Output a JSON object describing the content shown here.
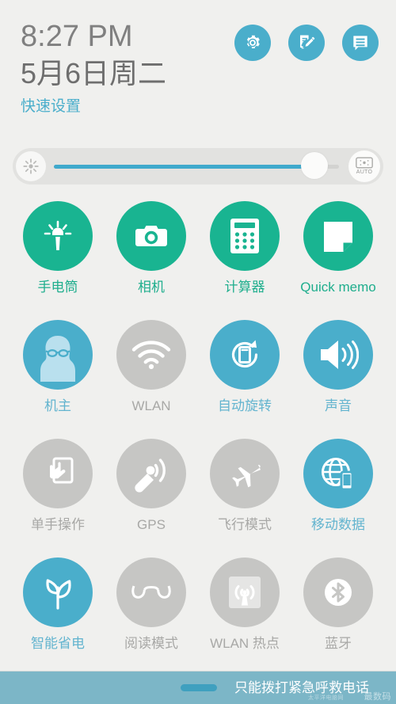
{
  "header": {
    "time": "8:27 PM",
    "date": "5月6日周二",
    "quick_settings_label": "快速设置",
    "icons": [
      {
        "name": "settings-gear-icon",
        "label": "设置"
      },
      {
        "name": "quick-memo-edit-icon",
        "label": "Quick memo"
      },
      {
        "name": "notifications-list-icon",
        "label": "通知"
      }
    ]
  },
  "brightness": {
    "left_icon": "brightness-sun-icon",
    "value_percent": 93,
    "auto_label": "AUTO",
    "auto_icon": "auto-brightness-icon"
  },
  "tiles": [
    {
      "label": "手电筒",
      "icon": "flashlight-icon",
      "state": "green"
    },
    {
      "label": "相机",
      "icon": "camera-icon",
      "state": "green"
    },
    {
      "label": "计算器",
      "icon": "calculator-icon",
      "state": "green"
    },
    {
      "label": "Quick memo",
      "icon": "quick-memo-icon",
      "state": "green"
    },
    {
      "label": "机主",
      "icon": "owner-avatar-icon",
      "state": "blue"
    },
    {
      "label": "WLAN",
      "icon": "wifi-icon",
      "state": "gray"
    },
    {
      "label": "自动旋转",
      "icon": "auto-rotate-icon",
      "state": "blue"
    },
    {
      "label": "声音",
      "icon": "sound-speaker-icon",
      "state": "blue"
    },
    {
      "label": "单手操作",
      "icon": "one-hand-mode-icon",
      "state": "gray"
    },
    {
      "label": "GPS",
      "icon": "gps-satellite-icon",
      "state": "gray"
    },
    {
      "label": "飞行模式",
      "icon": "airplane-icon",
      "state": "gray"
    },
    {
      "label": "移动数据",
      "icon": "mobile-data-icon",
      "state": "blue"
    },
    {
      "label": "智能省电",
      "icon": "power-saving-leaf-icon",
      "state": "blue"
    },
    {
      "label": "阅读模式",
      "icon": "reading-glasses-icon",
      "state": "gray"
    },
    {
      "label": "WLAN 热点",
      "icon": "hotspot-icon",
      "state": "gray"
    },
    {
      "label": "蓝牙",
      "icon": "bluetooth-icon",
      "state": "gray"
    }
  ],
  "bottom": {
    "emergency_text": "只能拨打紧急呼救电话",
    "watermark": "最数码",
    "watermark_sub": "太平洋电脑网"
  },
  "colors": {
    "green": "#19b491",
    "blue": "#4aaecb",
    "gray": "#c6c6c4",
    "background": "#f0f0ee",
    "bottom_bar": "#7cb6c7"
  }
}
